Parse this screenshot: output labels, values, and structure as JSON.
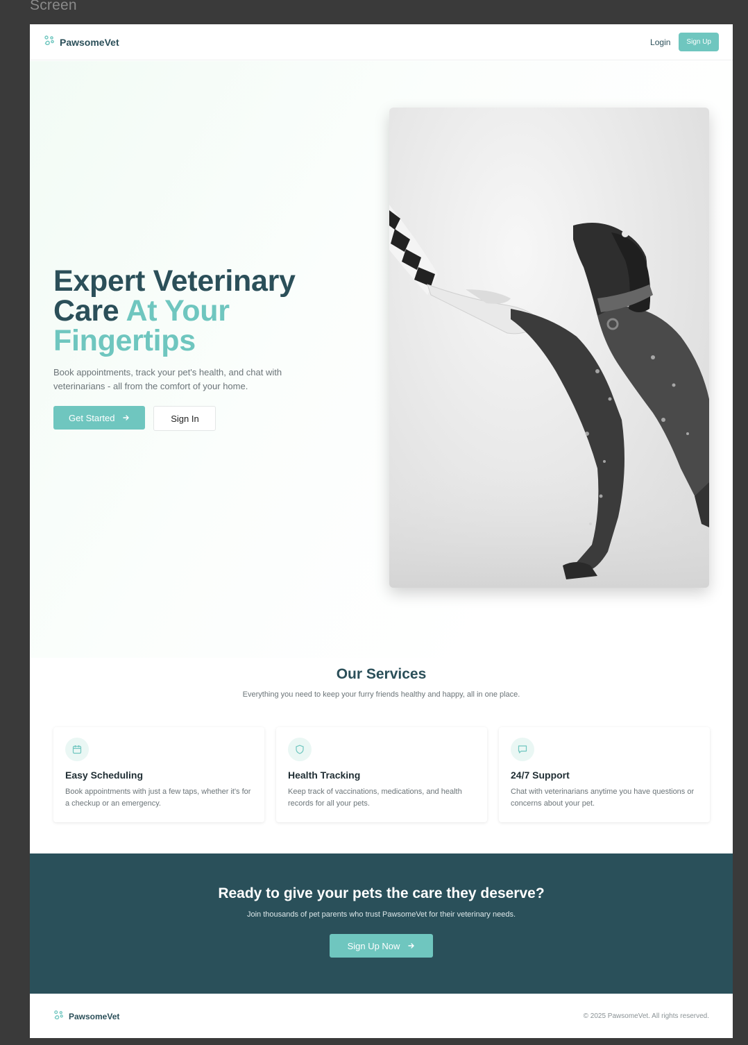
{
  "canvas_label": "Screen",
  "nav": {
    "brand": "PawsomeVet",
    "login": "Login",
    "signup": "Sign Up"
  },
  "hero": {
    "title_line1": "Expert Veterinary",
    "title_line2_dark": "Care ",
    "title_line2_accent": "At Your",
    "title_line3_accent": "Fingertips",
    "subtitle": "Book appointments, track your pet's health, and chat with veterinarians - all from the comfort of your home.",
    "get_started": "Get Started",
    "sign_in": "Sign In"
  },
  "services": {
    "title": "Our Services",
    "subtitle": "Everything you need to keep your furry friends healthy and happy, all in one place.",
    "items": [
      {
        "icon": "calendar-icon",
        "title": "Easy Scheduling",
        "desc": "Book appointments with just a few taps, whether it's for a checkup or an emergency."
      },
      {
        "icon": "shield-icon",
        "title": "Health Tracking",
        "desc": "Keep track of vaccinations, medications, and health records for all your pets."
      },
      {
        "icon": "chat-icon",
        "title": "24/7 Support",
        "desc": "Chat with veterinarians anytime you have questions or concerns about your pet."
      }
    ]
  },
  "cta": {
    "title": "Ready to give your pets the care they deserve?",
    "subtitle": "Join thousands of pet parents who trust PawsomeVet for their veterinary needs.",
    "button": "Sign Up Now"
  },
  "footer": {
    "brand": "PawsomeVet",
    "copyright": "© 2025 PawsomeVet. All rights reserved."
  },
  "colors": {
    "primary": "#2b4f59",
    "accent": "#6fc6bf",
    "cta_bg": "#2a505a"
  }
}
